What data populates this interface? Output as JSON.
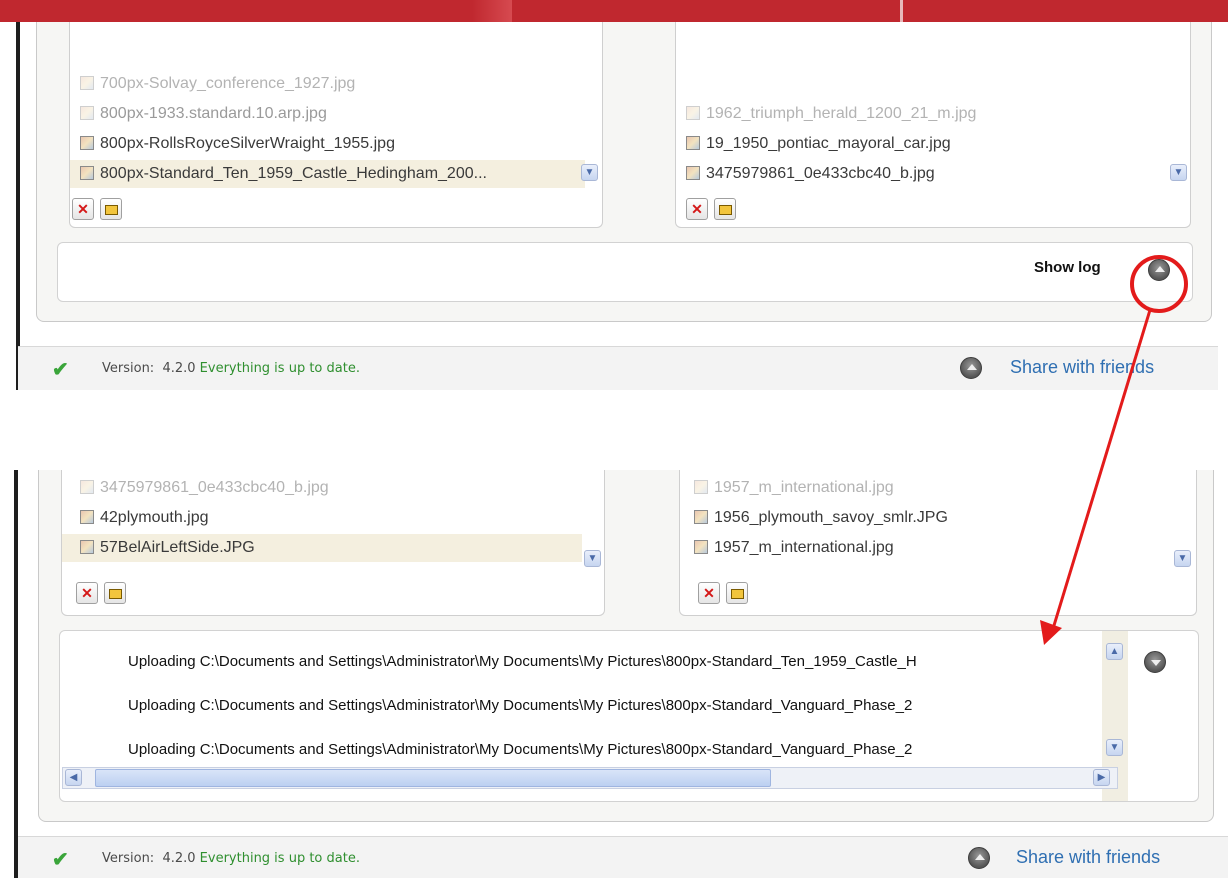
{
  "panel_top": {
    "left_files": [
      {
        "name": "700px-Solvay_conference_1927.jpg",
        "dim": true
      },
      {
        "name": "800px-1933.standard.10.arp.jpg",
        "dim": false,
        "soft": true
      },
      {
        "name": "800px-RollsRoyceSilverWraight_1955.jpg",
        "dim": false
      },
      {
        "name": "800px-Standard_Ten_1959_Castle_Hedingham_200...",
        "dim": false,
        "selected": true
      }
    ],
    "right_files": [
      {
        "name": "1962_triumph_herald_1200_21_m.jpg",
        "dim": true
      },
      {
        "name": "19_1950_pontiac_mayoral_car.jpg",
        "dim": false
      },
      {
        "name": "3475979861_0e433cbc40_b.jpg",
        "dim": false
      }
    ],
    "show_log_label": "Show log",
    "status": {
      "version_label": "Version:",
      "version": "4.2.0",
      "message": "Everything is up to date.",
      "share_label": "Share with friends"
    }
  },
  "panel_bottom": {
    "left_files": [
      {
        "name": "3475979861_0e433cbc40_b.jpg",
        "dim": true
      },
      {
        "name": "42plymouth.jpg",
        "dim": false
      },
      {
        "name": "57BelAirLeftSide.JPG",
        "dim": false,
        "selected": true
      }
    ],
    "right_files": [
      {
        "name": "1957_m_international.jpg",
        "dim": true
      },
      {
        "name": "1956_plymouth_savoy_smlr.JPG",
        "dim": false
      },
      {
        "name": "1957_m_international.jpg",
        "dim": false
      }
    ],
    "log_lines": [
      "Uploading C:\\Documents and Settings\\Administrator\\My Documents\\My Pictures\\800px-Standard_Ten_1959_Castle_H",
      "Uploading C:\\Documents and Settings\\Administrator\\My Documents\\My Pictures\\800px-Standard_Vanguard_Phase_2",
      "Uploading C:\\Documents and Settings\\Administrator\\My Documents\\My Pictures\\800px-Standard_Vanguard_Phase_2"
    ],
    "status": {
      "version_label": "Version:",
      "version": "4.2.0",
      "message": "Everything is up to date.",
      "share_label": "Share with friends"
    }
  },
  "colors": {
    "annotation_red": "#e31b1b",
    "link_blue": "#2f6fb2",
    "ok_green": "#2f8f2f"
  }
}
